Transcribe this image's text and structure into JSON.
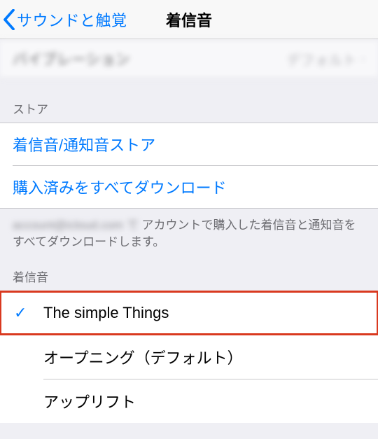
{
  "nav": {
    "back_label": "サウンドと触覚",
    "title": "着信音"
  },
  "vibration": {
    "label": "バイブレーション",
    "value": "デフォルト"
  },
  "store": {
    "header": "ストア",
    "tone_store": "着信音/通知音ストア",
    "download_all": "購入済みをすべてダウンロード",
    "footer_blur": "account@icloud.com で",
    "footer_text": "アカウントで購入した着信音と通知音をすべてダウンロードします。"
  },
  "ringtones": {
    "header": "着信音",
    "items": [
      {
        "label": "The simple Things",
        "selected": true
      },
      {
        "label": "オープニング（デフォルト）",
        "selected": false
      },
      {
        "label": "アップリフト",
        "selected": false
      }
    ]
  }
}
